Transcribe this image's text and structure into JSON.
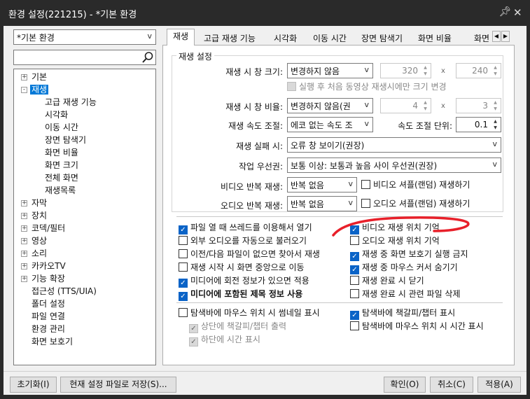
{
  "window": {
    "title": "환경 설정(221215) - *기본 환경"
  },
  "profile": {
    "selected": "*기본 환경"
  },
  "search": {
    "placeholder": ""
  },
  "tree": {
    "basic": "기본",
    "playback": "재생",
    "children": [
      "고급 재생 기능",
      "시각화",
      "이동 시간",
      "장면 탐색기",
      "화면 비율",
      "화면 크기",
      "전체 화면",
      "재생목록"
    ],
    "subtitles": "자막",
    "device": "장치",
    "codec": "코덱/필터",
    "video": "영상",
    "audio": "소리",
    "kakaotv": "카카오TV",
    "extensions": "기능 확장",
    "accessibility": "접근성 (TTS/UIA)",
    "folder": "폴더 설정",
    "association": "파일 연결",
    "profiles": "환경 관리",
    "screensaver": "화면 보호기"
  },
  "tabs": [
    "재생",
    "고급 재생 기능",
    "시각화",
    "이동 시간",
    "장면 탐색기",
    "화면 비율",
    "화면"
  ],
  "group": {
    "title": "재생 설정"
  },
  "fields": {
    "window_size_label": "재생 시 창 크기:",
    "window_size_value": "변경하지 않음",
    "width": "320",
    "height": "240",
    "first_only": "실행 후 처음 동영상 재생시에만 크기 변경",
    "window_ratio_label": "재생 시 창 비율:",
    "window_ratio_value": "변경하지 않음(권",
    "ratio_w": "4",
    "ratio_h": "3",
    "speed_label": "재생 속도 조절:",
    "speed_value": "에코 없는 속도 조",
    "speed_unit_label": "속도 조절 단위:",
    "speed_unit_value": "0.1",
    "fail_label": "재생 실패 시:",
    "fail_value": "오류 창 보이기(권장)",
    "priority_label": "작업 우선권:",
    "priority_value": "보통 이상: 보통과 높음 사이 우선권(권장)",
    "video_repeat_label": "비디오 반복 재생:",
    "video_repeat_value": "반복 없음",
    "video_shuffle": "비디오 셔플(랜덤) 재생하기",
    "audio_repeat_label": "오디오 반복 재생:",
    "audio_repeat_value": "반복 없음",
    "audio_shuffle": "오디오 셔플(랜덤) 재생하기",
    "x_sign": "x"
  },
  "checks_left": [
    {
      "label": "파일 열 때 쓰레드를 이용해서 열기",
      "checked": true
    },
    {
      "label": "외부 오디오를 자동으로 불러오기",
      "checked": false
    },
    {
      "label": "이전/다음 파일이 없으면 찾아서 재생",
      "checked": false
    },
    {
      "label": "재생 시작 시 화면 중앙으로 이동",
      "checked": false
    },
    {
      "label": "미디어에 회전 정보가 있으면 적용",
      "checked": true
    },
    {
      "label": "미디어에 포함된 제목 정보 사용",
      "checked": true
    }
  ],
  "checks_right": [
    {
      "label": "비디오 재생 위치 기억",
      "checked": true
    },
    {
      "label": "오디오 재생 위치 기억",
      "checked": false
    },
    {
      "label": "재생 중 화면 보호기 실행 금지",
      "checked": true
    },
    {
      "label": "재생 중 마우스 커서 숨기기",
      "checked": true
    },
    {
      "label": "재생 완료 시 닫기",
      "checked": false
    },
    {
      "label": "재생 완료 시 관련 파일 삭제",
      "checked": false
    }
  ],
  "seek": {
    "thumbnail": "탐색바에 마우스 위치 시 썸네일 표시",
    "top_chapter": "상단에 책갈피/챕터 출력",
    "bottom_time": "하단에 시간 표시",
    "chapter": "탐색바에 책갈피/챕터 표시",
    "mouse_time": "탐색바에 마우스 위치 시 시간 표시"
  },
  "buttons": {
    "reset": "초기화(I)",
    "save": "현재 설정 파일로 저장(S)...",
    "ok": "확인(O)",
    "cancel": "취소(C)",
    "apply": "적용(A)"
  },
  "colors": {
    "accent": "#0078d7",
    "check": "#0a63c7",
    "annotation": "#e8202a",
    "titlebar": "#2a2a2a"
  },
  "icons": {
    "pin": "pin-icon",
    "close": "close-icon",
    "search": "search-icon"
  }
}
